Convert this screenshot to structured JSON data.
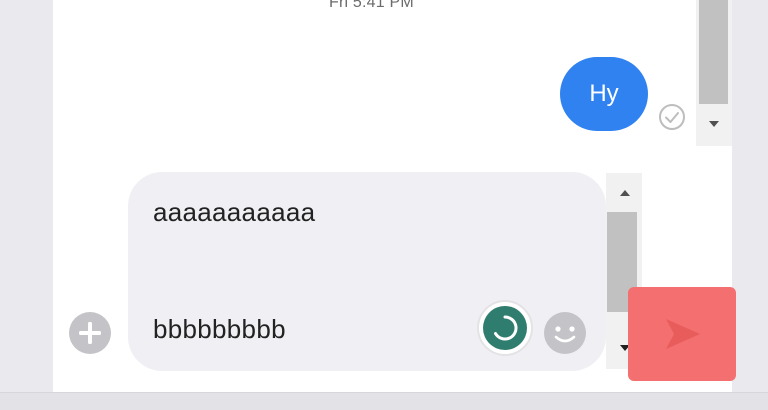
{
  "chat": {
    "timestamp": "Fri 5:41 PM",
    "messages": [
      {
        "text": "Hy",
        "status_icon": "check-circle-icon"
      }
    ]
  },
  "composer": {
    "line1": "aaaaaaaaaaa",
    "line2": "bbbbbbbbb",
    "icons": {
      "add": "plus-circle-icon",
      "loading": "spinner-icon",
      "emoji": "smiley-icon",
      "send": "send-icon"
    }
  },
  "colors": {
    "sent_bubble": "#2f82f0",
    "send_button": "#f46f6f",
    "spinner": "#2e7d6e",
    "icon_gray": "#c4c4c8"
  }
}
